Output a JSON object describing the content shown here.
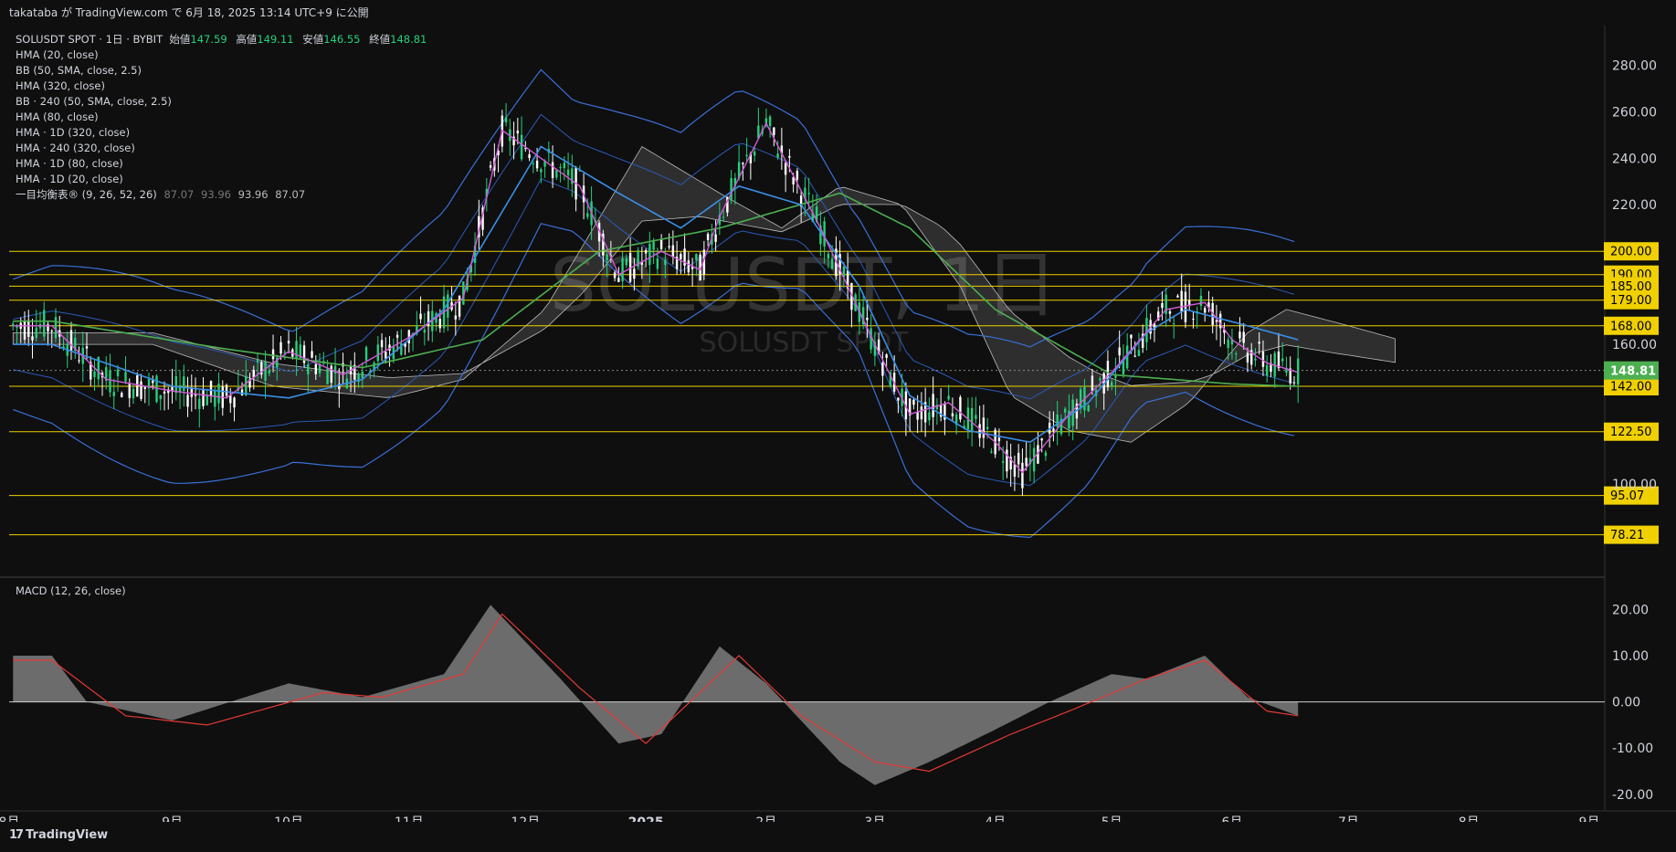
{
  "header": {
    "publish_text": "takataba が TradingView.com で 6月 18, 2025 13:14 UTC+9 に公開"
  },
  "legend": {
    "symbol": "SOLUSDT SPOT · 1日 · BYBIT",
    "open_label": "始値",
    "open": "147.59",
    "high_label": "高値",
    "high": "149.11",
    "low_label": "安値",
    "low": "146.55",
    "close_label": "終値",
    "close": "148.81",
    "indicators": [
      "HMA (20, close)",
      "BB (50, SMA, close, 2.5)",
      "HMA (320, close)",
      "BB · 240 (50, SMA, close, 2.5)",
      "HMA (80, close)",
      "HMA · 1D (320, close)",
      "HMA · 240 (320, close)",
      "HMA · 1D (80, close)",
      "HMA · 1D (20, close)"
    ],
    "ichimoku": {
      "label": "一目均衡表® (9, 26, 52, 26)",
      "v1": "87.07",
      "v2": "93.96",
      "v3": "93.96",
      "v4": "87.07"
    }
  },
  "watermark": {
    "big": "SOLUSDT, 1日",
    "small": "SOLUSDT SPOT"
  },
  "macd_label": "MACD (12, 26, close)",
  "brand": "TradingView",
  "colors": {
    "background": "#0f0f0f",
    "up": "#26d07c",
    "down": "#ffffff",
    "hma20": "#d15ad7",
    "hma80": "#3a8fe8",
    "hma320": "#4caf50",
    "bb": "#3a6fd8",
    "level": "#f0d000",
    "price_tag": "#4caf50",
    "macd_hist": "#8c8c8c",
    "macd_signal": "#e53935"
  },
  "chart_data": [
    {
      "type": "line",
      "title": "SOLUSDT, 1日",
      "price_axis": {
        "ticks": [
          280,
          260,
          240,
          220,
          160,
          100
        ]
      },
      "ylim": [
        60,
        297
      ],
      "x_labels": [
        "8月",
        "9月",
        "10月",
        "11月",
        "12月",
        "2025",
        "2月",
        "3月",
        "4月",
        "5月",
        "6月",
        "7月",
        "8月",
        "9月"
      ],
      "horizontal_levels": [
        "200.00",
        "190.00",
        "185.00",
        "179.00",
        "168.00",
        "142.00",
        "122.50",
        "95.07",
        "78.21"
      ],
      "last_price": "148.81",
      "series": [
        {
          "name": "HMA (20, close)",
          "x": [
            "2024-08-01",
            "2024-08-15",
            "2024-09-01",
            "2024-09-15",
            "2024-10-01",
            "2024-10-15",
            "2024-11-01",
            "2024-11-15",
            "2024-11-25",
            "2024-12-05",
            "2024-12-15",
            "2024-12-25",
            "2025-01-05",
            "2025-01-15",
            "2025-01-20",
            "2025-02-01",
            "2025-02-15",
            "2025-03-01",
            "2025-03-10",
            "2025-03-20",
            "2025-04-01",
            "2025-04-08",
            "2025-04-20",
            "2025-05-01",
            "2025-05-15",
            "2025-05-25",
            "2025-06-01",
            "2025-06-10",
            "2025-06-18"
          ],
          "y": [
            168,
            145,
            140,
            137,
            157,
            147,
            163,
            180,
            252,
            240,
            228,
            190,
            200,
            192,
            215,
            255,
            210,
            160,
            130,
            135,
            118,
            105,
            130,
            148,
            175,
            178,
            162,
            152,
            148
          ]
        },
        {
          "name": "HMA (80, close)",
          "x": [
            "2024-08-01",
            "2024-09-01",
            "2024-10-01",
            "2024-10-20",
            "2024-11-10",
            "2024-12-05",
            "2024-12-25",
            "2025-01-10",
            "2025-01-25",
            "2025-02-10",
            "2025-02-25",
            "2025-03-10",
            "2025-03-25",
            "2025-04-10",
            "2025-04-25",
            "2025-05-10",
            "2025-05-20",
            "2025-06-05",
            "2025-06-18"
          ],
          "y": [
            160,
            142,
            137,
            145,
            175,
            245,
            225,
            210,
            228,
            220,
            185,
            138,
            123,
            118,
            135,
            165,
            175,
            168,
            162
          ]
        },
        {
          "name": "HMA (320, close)",
          "x": [
            "2024-08-01",
            "2024-09-15",
            "2024-10-20",
            "2024-11-20",
            "2024-12-20",
            "2025-01-20",
            "2025-02-20",
            "2025-03-10",
            "2025-04-01",
            "2025-05-01",
            "2025-06-01",
            "2025-06-18"
          ],
          "y": [
            170,
            158,
            150,
            162,
            200,
            210,
            225,
            210,
            175,
            147,
            143,
            142
          ]
        }
      ]
    },
    {
      "type": "area",
      "title": "MACD (12, 26, close)",
      "ylim": [
        -22,
        25
      ],
      "y_ticks": [
        20,
        10,
        0,
        -10,
        -20
      ],
      "series": [
        {
          "name": "MACD",
          "x": [
            "2024-08-01",
            "2024-08-10",
            "2024-09-01",
            "2024-10-01",
            "2024-10-20",
            "2024-11-10",
            "2024-11-22",
            "2024-12-10",
            "2024-12-25",
            "2025-01-05",
            "2025-01-20",
            "2025-02-01",
            "2025-02-20",
            "2025-03-01",
            "2025-03-15",
            "2025-04-01",
            "2025-04-15",
            "2025-05-01",
            "2025-05-10",
            "2025-05-25",
            "2025-06-05",
            "2025-06-18"
          ],
          "y": [
            10,
            0,
            -4,
            4,
            1,
            6,
            21,
            5,
            -9,
            -7,
            12,
            4,
            -13,
            -18,
            -13,
            -6,
            0,
            6,
            5,
            10,
            1,
            -3
          ]
        },
        {
          "name": "Signal",
          "x": [
            "2024-08-01",
            "2024-08-20",
            "2024-09-10",
            "2024-10-10",
            "2024-10-25",
            "2024-11-15",
            "2024-11-25",
            "2024-12-15",
            "2025-01-01",
            "2025-01-25",
            "2025-02-10",
            "2025-03-01",
            "2025-03-15",
            "2025-04-05",
            "2025-04-20",
            "2025-05-10",
            "2025-05-25",
            "2025-06-10",
            "2025-06-18"
          ],
          "y": [
            9,
            -3,
            -5,
            2,
            1,
            6,
            19,
            3,
            -9,
            10,
            -3,
            -13,
            -15,
            -7,
            -2,
            5,
            9,
            -2,
            -3
          ]
        }
      ]
    }
  ]
}
